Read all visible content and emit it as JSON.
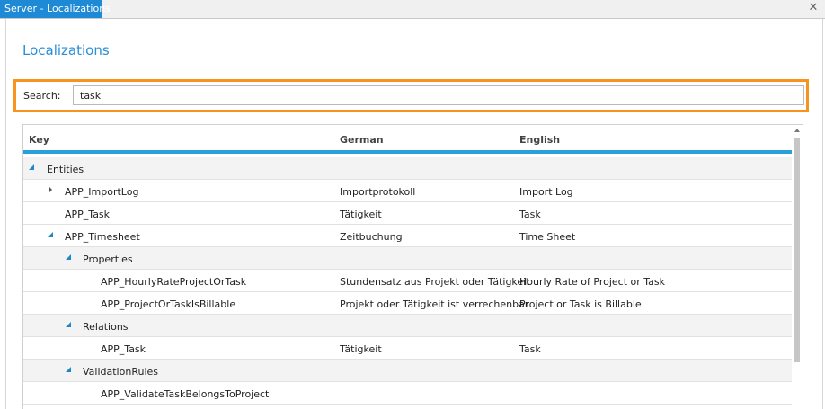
{
  "window": {
    "title": "Server - Localizations",
    "close_glyph": "✕"
  },
  "page": {
    "title": "Localizations"
  },
  "search": {
    "label": "Search:",
    "value": "task"
  },
  "grid": {
    "columns": {
      "key": "Key",
      "german": "German",
      "english": "English"
    },
    "rows": [
      {
        "key": "Entities",
        "german": "",
        "english": "",
        "level": 0,
        "toggle": "collapse",
        "group": true
      },
      {
        "key": "APP_ImportLog",
        "german": "Importprotokoll",
        "english": "Import Log",
        "level": 1,
        "toggle": "expand",
        "group": false
      },
      {
        "key": "APP_Task",
        "german": "Tätigkeit",
        "english": "Task",
        "level": 1,
        "toggle": "none",
        "group": false
      },
      {
        "key": "APP_Timesheet",
        "german": "Zeitbuchung",
        "english": "Time Sheet",
        "level": 1,
        "toggle": "collapse",
        "group": false
      },
      {
        "key": "Properties",
        "german": "",
        "english": "",
        "level": 2,
        "toggle": "collapse",
        "group": true
      },
      {
        "key": "APP_HourlyRateProjectOrTask",
        "german": "Stundensatz aus Projekt oder Tätigkeit",
        "english": "Hourly Rate of Project or Task",
        "level": 3,
        "toggle": "none",
        "group": false
      },
      {
        "key": "APP_ProjectOrTaskIsBillable",
        "german": "Projekt oder Tätigkeit ist verrechenbar",
        "english": "Project or Task is Billable",
        "level": 3,
        "toggle": "none",
        "group": false
      },
      {
        "key": "Relations",
        "german": "",
        "english": "",
        "level": 2,
        "toggle": "collapse",
        "group": true
      },
      {
        "key": "APP_Task",
        "german": "Tätigkeit",
        "english": "Task",
        "level": 3,
        "toggle": "none",
        "group": false
      },
      {
        "key": "ValidationRules",
        "german": "",
        "english": "",
        "level": 2,
        "toggle": "collapse",
        "group": true
      },
      {
        "key": "APP_ValidateTaskBelongsToProject",
        "german": "",
        "english": "",
        "level": 3,
        "toggle": "none",
        "group": false
      }
    ]
  }
}
